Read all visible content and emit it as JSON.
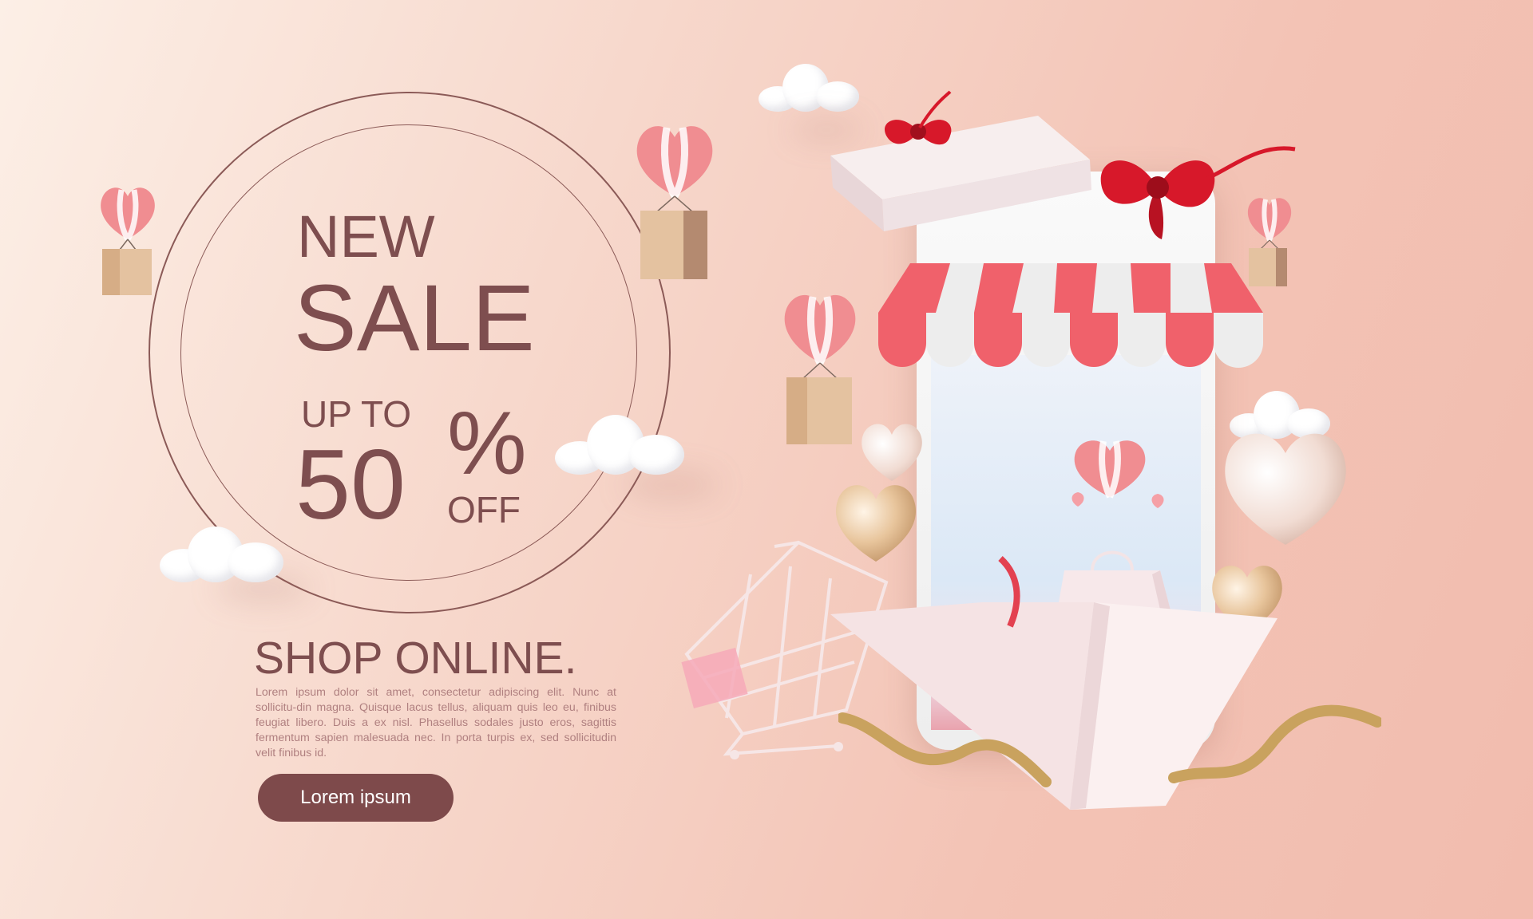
{
  "promo": {
    "line_new": "NEW",
    "line_sale": "SALE",
    "line_up_to": "UP TO",
    "discount_value": "50",
    "percent_sign": "%",
    "off_label": "OFF"
  },
  "shop": {
    "heading": "SHOP ONLINE.",
    "body": "Lorem ipsum dolor sit amet, consectetur adipiscing elit. Nunc at sollicitu-din magna. Quisque lacus tellus, aliquam quis leo eu, finibus feugiat libero. Duis a ex nisl. Phasellus sodales justo eros, sagittis fermentum sapien malesuada nec. In porta turpis ex, sed sollicitudin velit finibus id.",
    "cta_label": "Lorem ipsum"
  },
  "colors": {
    "text_brown": "#7e4e4f",
    "button_bg": "#7e4a4b",
    "awning_red": "#f0616b",
    "bow_red": "#d7182a",
    "gold": "#c9a25e"
  },
  "icons": [
    "heart-balloon-icon",
    "cloud-icon",
    "gift-box-icon",
    "shopping-cart-icon",
    "shopping-bag-icon",
    "smartphone-icon",
    "awning-icon",
    "heart-icon",
    "ribbon-icon"
  ]
}
